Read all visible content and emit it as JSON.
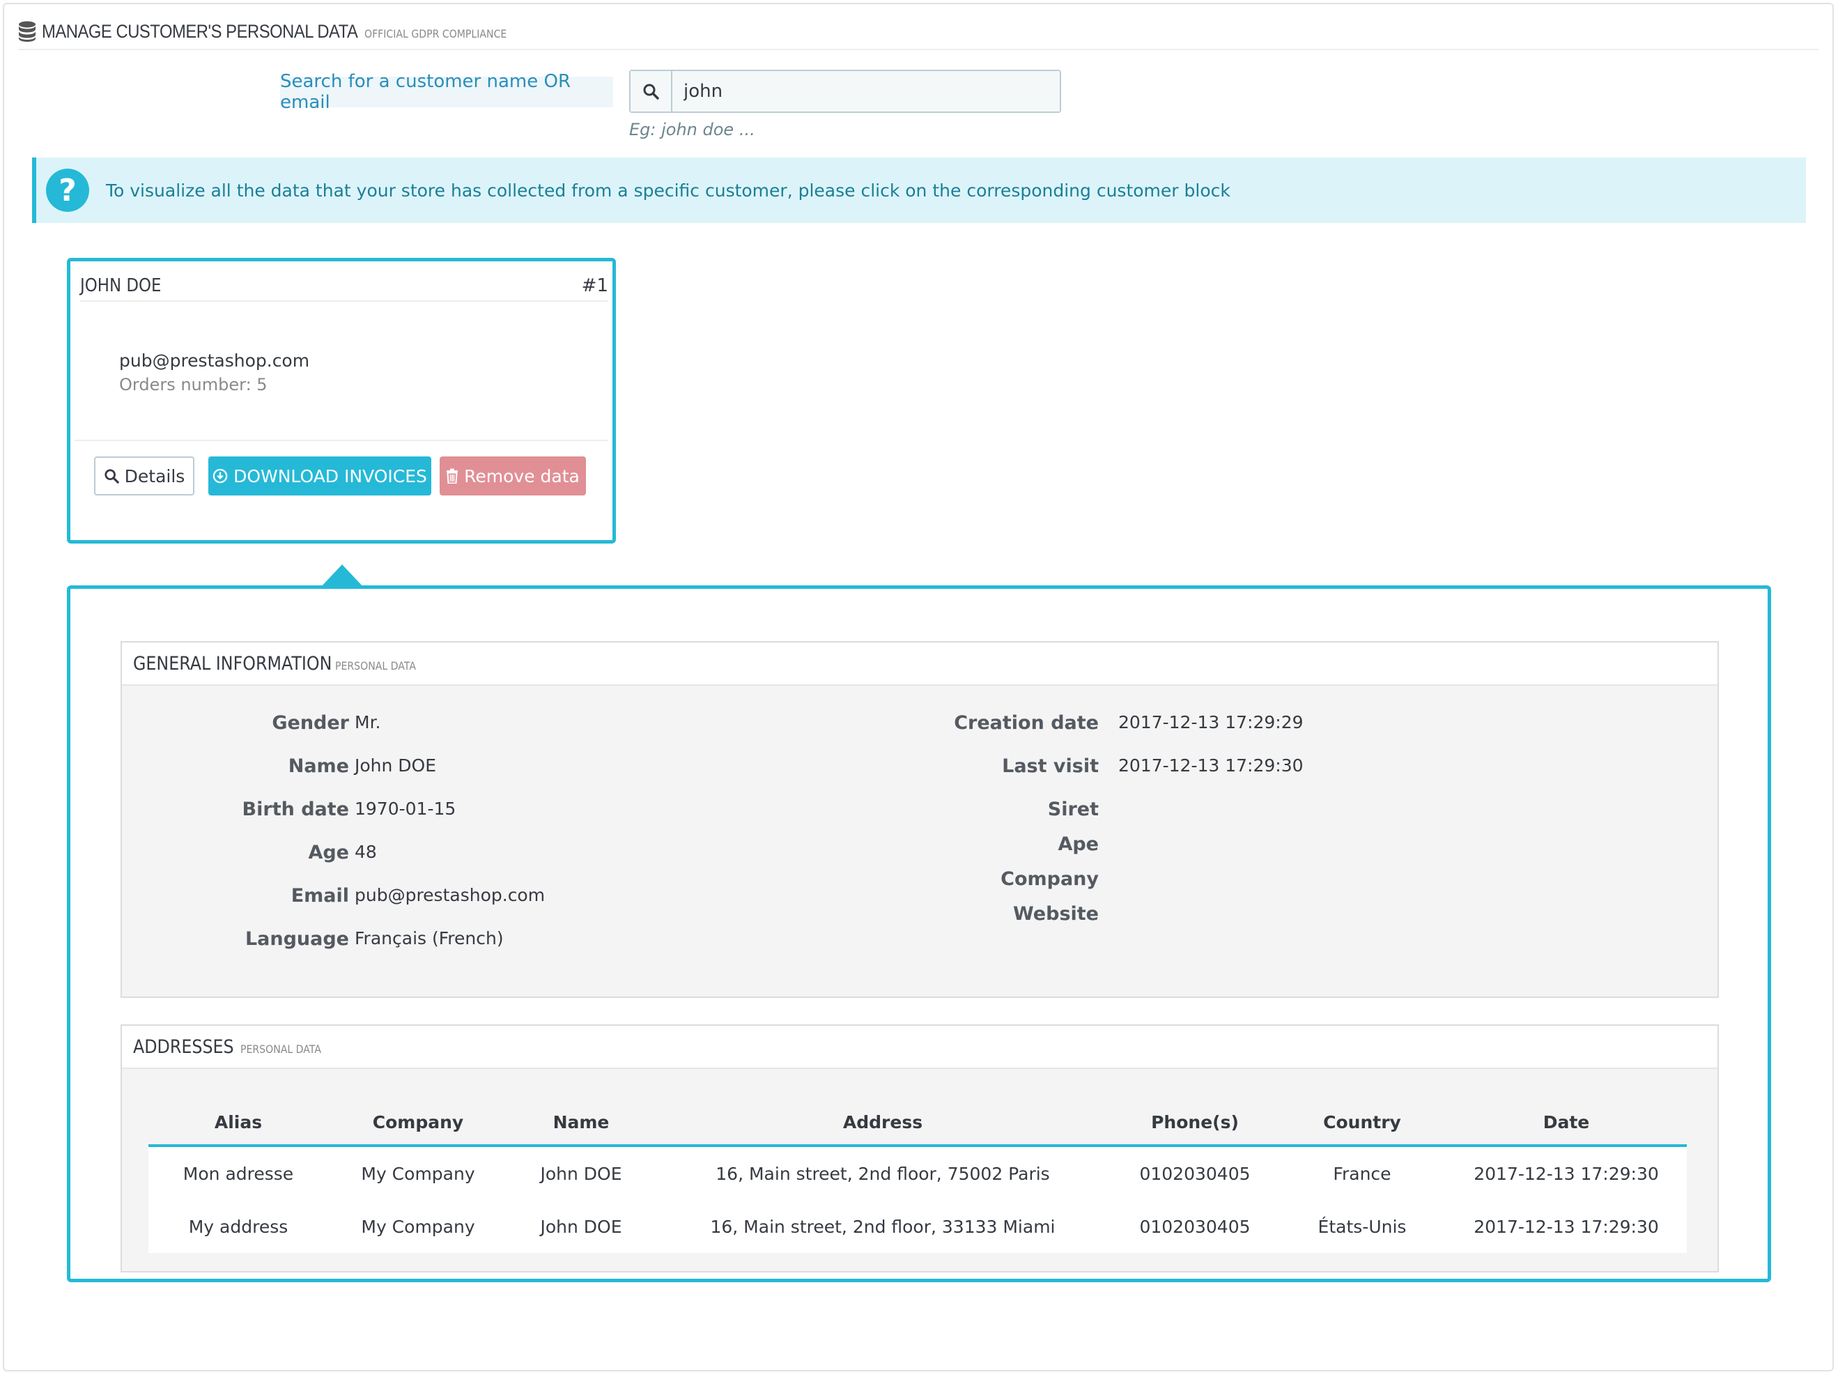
{
  "header": {
    "title": "MANAGE CUSTOMER'S PERSONAL DATA",
    "subtitle": "OFFICIAL GDPR COMPLIANCE",
    "icon": "database-icon"
  },
  "search": {
    "label": "Search for a customer name OR email",
    "value": "john",
    "help": "Eg: john doe ..."
  },
  "alert": {
    "text": "To visualize all the data that your store has collected from a specific customer, please click on the corresponding customer block",
    "icon": "?"
  },
  "customer": {
    "name": "JOHN DOE",
    "id": "#1",
    "email": "pub@prestashop.com",
    "orders": "Orders number: 5",
    "details_label": "Details",
    "download_label": "DOWNLOAD INVOICES",
    "remove_label": "Remove data"
  },
  "general": {
    "title": "GENERAL INFORMATION",
    "subtitle": "PERSONAL DATA",
    "left": [
      {
        "label": "Gender",
        "value": "Mr."
      },
      {
        "label": "Name",
        "value": "John DOE"
      },
      {
        "label": "Birth date",
        "value": "1970-01-15"
      },
      {
        "label": "Age",
        "value": "48"
      },
      {
        "label": "Email",
        "value": "pub@prestashop.com"
      },
      {
        "label": "Language",
        "value": "Français (French)"
      }
    ],
    "right": [
      {
        "label": "Creation date",
        "value": "2017-12-13 17:29:29"
      },
      {
        "label": "Last visit",
        "value": "2017-12-13 17:29:30"
      },
      {
        "label": "Siret",
        "value": ""
      },
      {
        "label": "Ape",
        "value": ""
      },
      {
        "label": "Company",
        "value": ""
      },
      {
        "label": "Website",
        "value": ""
      }
    ]
  },
  "addresses": {
    "title": "ADDRESSES",
    "subtitle": "PERSONAL DATA",
    "columns": [
      "Alias",
      "Company",
      "Name",
      "Address",
      "Phone(s)",
      "Country",
      "Date"
    ],
    "rows": [
      [
        "Mon adresse",
        "My Company",
        "John DOE",
        "16, Main street, 2nd floor, 75002 Paris",
        "0102030405",
        "France",
        "2017-12-13 17:29:30"
      ],
      [
        "My address",
        "My Company",
        "John DOE",
        "16, Main street, 2nd floor, 33133 Miami",
        "0102030405",
        "États-Unis",
        "2017-12-13 17:29:30"
      ]
    ]
  },
  "colors": {
    "accent": "#25b9d7",
    "danger": "#e08f95",
    "info_bg": "#dcf4f9"
  }
}
